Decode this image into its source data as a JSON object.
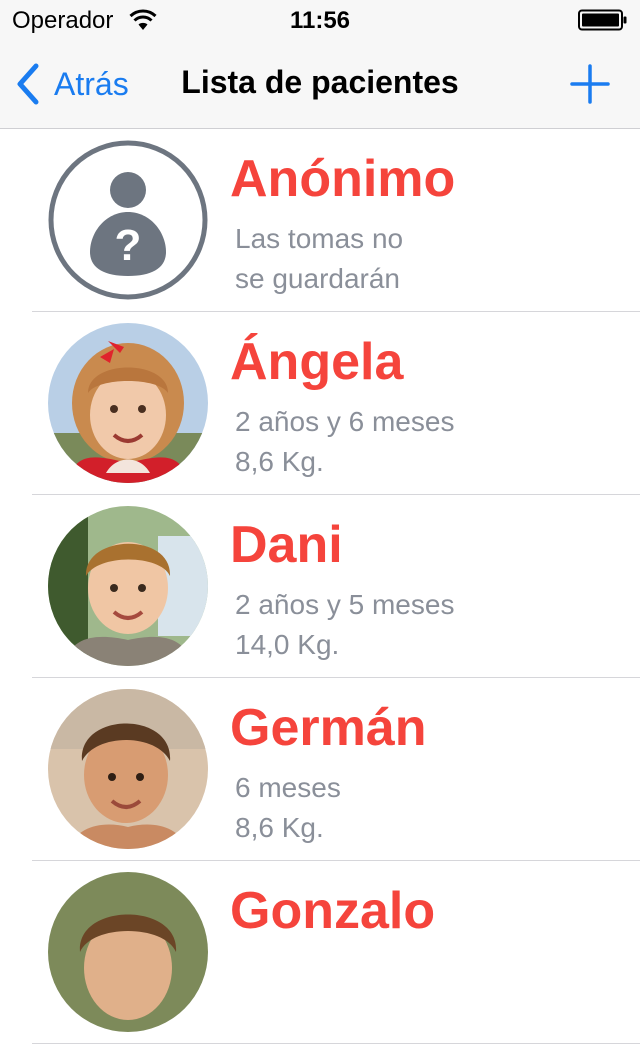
{
  "status_bar": {
    "carrier": "Operador",
    "time": "11:56"
  },
  "nav": {
    "back_label": "Atrás",
    "title": "Lista de pacientes"
  },
  "colors": {
    "accent": "#1a7cf0",
    "name": "#f5443c",
    "detail": "#8a8f99"
  },
  "patients": [
    {
      "name": "Anónimo",
      "line1": "Las tomas no",
      "line2": "se guardarán",
      "avatar": "anonymous-avatar-icon"
    },
    {
      "name": "Ángela",
      "line1": "2 años y 6 meses",
      "line2": "8,6 Kg.",
      "avatar": "photo"
    },
    {
      "name": "Dani",
      "line1": "2 años y 5 meses",
      "line2": "14,0 Kg.",
      "avatar": "photo"
    },
    {
      "name": "Germán",
      "line1": "6 meses",
      "line2": "8,6 Kg.",
      "avatar": "photo"
    },
    {
      "name": "Gonzalo",
      "line1": "",
      "line2": "",
      "avatar": "photo"
    }
  ]
}
